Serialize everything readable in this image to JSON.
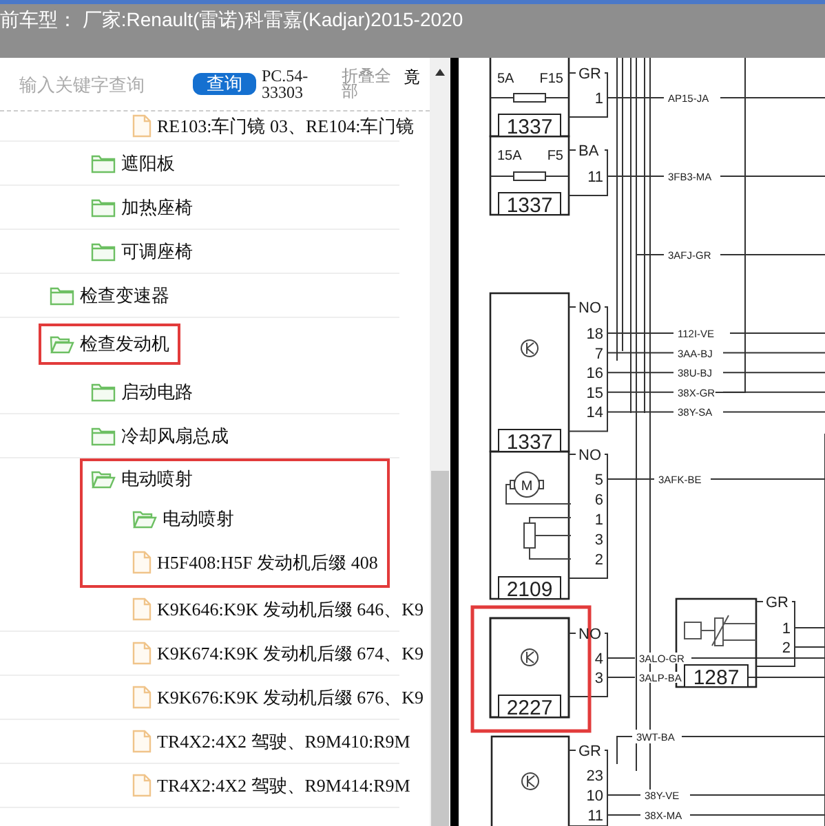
{
  "title_bar": {
    "title": "前车型： 厂家:Renault(雷诺)科雷嘉(Kadjar)2015-2020"
  },
  "search": {
    "placeholder": "输入关键字查询",
    "button": "查询",
    "code": "PC.54-33303",
    "collapse": "折叠全部",
    "extra": "竟"
  },
  "tree": [
    {
      "children": [
        {
          "children": [
            {
              "label": "RE103:车门镜 03、RE104:车门镜",
              "kind": "file",
              "marked": false
            }
          ]
        },
        {
          "label": "遮阳板",
          "kind": "folder",
          "expanded": false,
          "marked": false
        },
        {
          "label": "加热座椅",
          "kind": "folder",
          "expanded": false,
          "marked": false
        },
        {
          "label": "可调座椅",
          "kind": "folder",
          "expanded": false,
          "marked": false
        }
      ]
    },
    {
      "label": "检查变速器",
      "kind": "folder",
      "expanded": false,
      "marked": false
    },
    {
      "label": "检查发动机",
      "kind": "folder",
      "expanded": true,
      "marked": true,
      "children": [
        {
          "label": "启动电路",
          "kind": "folder",
          "expanded": false,
          "marked": false
        },
        {
          "label": "冷却风扇总成",
          "kind": "folder",
          "expanded": false,
          "marked": false
        },
        {
          "label": "电动喷射",
          "kind": "folder",
          "expanded": true,
          "marked": true,
          "children": [
            {
              "label": "电动喷射",
              "kind": "folder",
              "expanded": true,
              "marked": true
            },
            {
              "label": "H5F408:H5F 发动机后缀 408",
              "kind": "file",
              "marked": true
            },
            {
              "label": "K9K646:K9K 发动机后缀 646、K9",
              "kind": "file",
              "marked": false
            },
            {
              "label": "K9K674:K9K 发动机后缀 674、K9",
              "kind": "file",
              "marked": false
            },
            {
              "label": "K9K676:K9K 发动机后缀 676、K9",
              "kind": "file",
              "marked": false
            },
            {
              "label": "TR4X2:4X2 驾驶、R9M410:R9M",
              "kind": "file",
              "marked": false
            },
            {
              "label": "TR4X2:4X2 驾驶、R9M414:R9M",
              "kind": "file",
              "marked": false
            }
          ]
        }
      ]
    }
  ],
  "diagram": {
    "components": [
      {
        "kind": "fuse",
        "number": "1337",
        "rating": "5A",
        "fuse_id": "F15",
        "connector": "GR",
        "marked": false,
        "pins": [
          {
            "pin": "1",
            "wire": "AP15-JA"
          }
        ]
      },
      {
        "kind": "fuse",
        "number": "1337",
        "rating": "15A",
        "fuse_id": "F5",
        "connector": "BA",
        "marked": false,
        "pins": [
          {
            "pin": "11",
            "wire": "3FB3-MA"
          }
        ]
      },
      {
        "kind": "ecu",
        "number": "1337",
        "connector": "NO",
        "marked": false,
        "pins": [
          {
            "pin": "18",
            "wire": "112I-VE"
          },
          {
            "pin": "7",
            "wire": "3AA-BJ"
          },
          {
            "pin": "16",
            "wire": "38U-BJ"
          },
          {
            "pin": "15",
            "wire": "38X-GR"
          },
          {
            "pin": "14",
            "wire": "38Y-SA"
          }
        ]
      },
      {
        "kind": "motor",
        "number": "2109",
        "symbol": "M",
        "connector": "NO",
        "marked": false,
        "pins": [
          {
            "pin": "5",
            "wire": "3AFK-BE"
          },
          {
            "pin": "6"
          },
          {
            "pin": "1"
          },
          {
            "pin": "3"
          },
          {
            "pin": "2"
          }
        ]
      },
      {
        "kind": "ecu",
        "number": "2227",
        "connector": "NO",
        "marked": true,
        "pins": [
          {
            "pin": "4",
            "wire": "3ALO-GR"
          },
          {
            "pin": "3",
            "wire": "3ALP-BA"
          }
        ]
      },
      {
        "kind": "sensor",
        "number": "1287",
        "connector": "GR",
        "marked": false,
        "pins": [
          {
            "pin": "1"
          },
          {
            "pin": "2"
          }
        ]
      },
      {
        "kind": "ecu",
        "connector": "GR",
        "marked": false,
        "pins": [
          {
            "pin": "23"
          },
          {
            "pin": "10",
            "wire": "38Y-VE"
          },
          {
            "pin": "11",
            "wire": "38X-MA"
          }
        ]
      }
    ],
    "wires": [
      {
        "label": "3AFJ-GR"
      },
      {
        "label": "3WT-BA"
      }
    ]
  }
}
